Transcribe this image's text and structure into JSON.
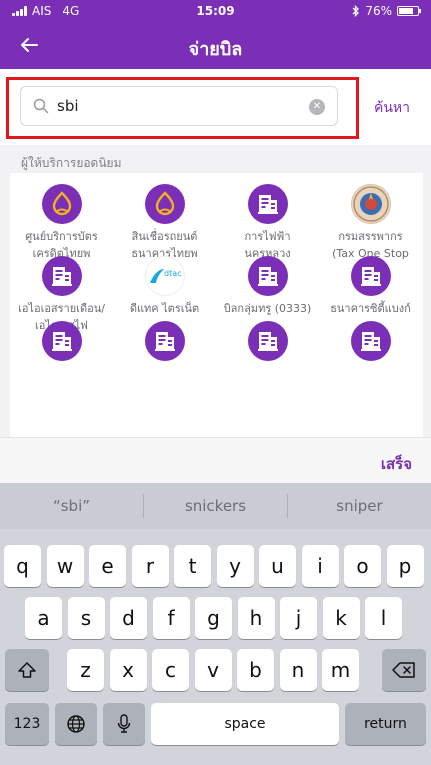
{
  "status": {
    "carrier": "AIS",
    "network": "4G",
    "time": "15:09",
    "battery": "76%",
    "battery_level": 0.76,
    "bluetooth": "bluetooth-icon"
  },
  "nav": {
    "title": "จ่ายบิล",
    "back_icon": "back-arrow-icon"
  },
  "search": {
    "value": "sbi",
    "button": "ค้นหา",
    "icon": "search-icon",
    "clear_icon": "clear-icon"
  },
  "providers": {
    "title": "ผู้ให้บริการยอดนิยม",
    "items": [
      {
        "label": "ศูนย์บริการบัตร\nเครดิตไทยพ",
        "icon": "scb-logo-icon"
      },
      {
        "label": "สินเชื่อรถยนต์\nธนาคารไทยพ",
        "icon": "scb-logo-icon"
      },
      {
        "label": "การไฟฟ้า\nนครหลวง",
        "icon": "bill-building-icon"
      },
      {
        "label": "กรมสรรพากร\n(Tax One Stop",
        "icon": "revenue-department-seal-icon"
      },
      {
        "label": "เอไอเอสรายเดือน/\nเอไอเอสไฟ",
        "icon": "bill-building-icon"
      },
      {
        "label": "ดีแทค ไตรเน็ต",
        "icon": "dtac-logo-icon",
        "logo_text": "dtac"
      },
      {
        "label": "บิลกลุ่มทรู (0333)",
        "icon": "bill-building-icon"
      },
      {
        "label": "ธนาคารซิตี้แบงก์",
        "icon": "bill-building-icon"
      },
      {
        "label": "",
        "icon": "bill-building-icon"
      },
      {
        "label": "",
        "icon": "bill-building-icon"
      },
      {
        "label": "",
        "icon": "bill-building-icon"
      },
      {
        "label": "",
        "icon": "bill-building-icon"
      }
    ]
  },
  "done_label": "เสร็จ",
  "keyboard": {
    "suggestions": [
      "“sbi”",
      "snickers",
      "sniper"
    ],
    "row1": [
      "q",
      "w",
      "e",
      "r",
      "t",
      "y",
      "u",
      "i",
      "o",
      "p"
    ],
    "row2": [
      "a",
      "s",
      "d",
      "f",
      "g",
      "h",
      "j",
      "k",
      "l"
    ],
    "row3": [
      "z",
      "x",
      "c",
      "v",
      "b",
      "n",
      "m"
    ],
    "shift_icon": "shift-icon",
    "delete_icon": "delete-icon",
    "numbers": "123",
    "globe_icon": "globe-icon",
    "mic_icon": "microphone-icon",
    "space": "space",
    "return": "return"
  },
  "colors": {
    "brand": "#7B2FB6",
    "highlight": "#E2161C",
    "scb_gold": "#F2B122"
  }
}
